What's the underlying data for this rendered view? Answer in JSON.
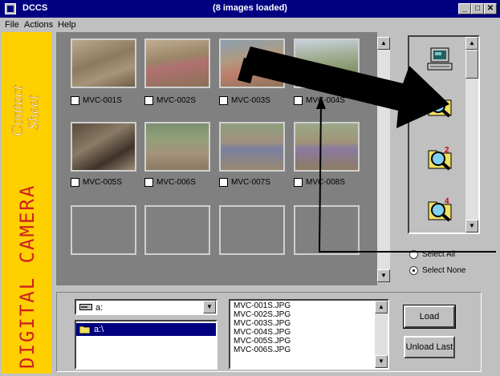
{
  "window": {
    "app_name": "DCCS",
    "title": "(8 images loaded)"
  },
  "menu": [
    "File",
    "Actions",
    "Help"
  ],
  "banner": {
    "line1": "Contact",
    "line2": "Sheet",
    "sub": "DIGITAL CAMERA"
  },
  "thumbnails": [
    {
      "label": "MVC-001S",
      "checked": false
    },
    {
      "label": "MVC-002S",
      "checked": false
    },
    {
      "label": "MVC-003S",
      "checked": false
    },
    {
      "label": "MVC-004S",
      "checked": false
    },
    {
      "label": "MVC-005S",
      "checked": false
    },
    {
      "label": "MVC-006S",
      "checked": false
    },
    {
      "label": "MVC-007S",
      "checked": false
    },
    {
      "label": "MVC-008S",
      "checked": false
    }
  ],
  "tools": [
    {
      "icon": "computer-icon"
    },
    {
      "icon": "magnify-folder-icon"
    },
    {
      "icon": "magnify-folder-2-icon",
      "badge": "2"
    },
    {
      "icon": "magnify-folder-4-icon",
      "badge": "4"
    }
  ],
  "selection": {
    "select_all": "Select All",
    "select_none": "Select None",
    "selected": "select_none"
  },
  "drive": {
    "value": "a:"
  },
  "directory": {
    "selected": "a:\\"
  },
  "files": [
    "MVC-001S.JPG",
    "MVC-002S.JPG",
    "MVC-003S.JPG",
    "MVC-004S.JPG",
    "MVC-005S.JPG",
    "MVC-006S.JPG"
  ],
  "buttons": {
    "load": "Load",
    "unload_last": "Unload Last"
  }
}
